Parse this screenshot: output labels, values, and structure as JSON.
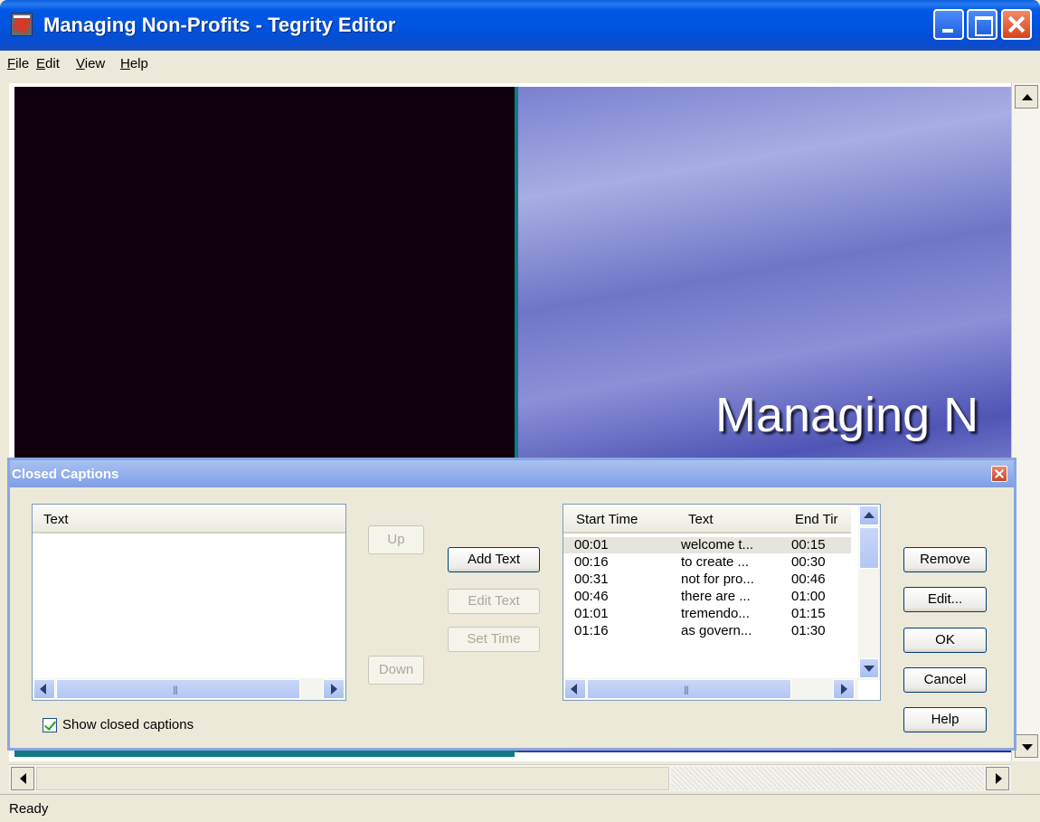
{
  "window": {
    "title": "Managing Non-Profits - Tegrity Editor"
  },
  "menu": [
    {
      "label": "File",
      "key": "F",
      "rest": "ile"
    },
    {
      "label": "Edit",
      "key": "E",
      "rest": "dit"
    },
    {
      "label": "View",
      "key": "V",
      "rest": "iew"
    },
    {
      "label": "Help",
      "key": "H",
      "rest": "elp"
    }
  ],
  "slide": {
    "title": "Managing N"
  },
  "status": {
    "text": "Ready"
  },
  "dialog": {
    "title": "Closed Captions",
    "text_list": {
      "header": "Text"
    },
    "buttons": {
      "up": "Up",
      "down": "Down",
      "add_text": "Add Text",
      "edit_text": "Edit Text",
      "set_time": "Set Time",
      "remove": "Remove",
      "edit": "Edit...",
      "ok": "OK",
      "cancel": "Cancel",
      "help": "Help"
    },
    "caption_list": {
      "headers": [
        "Start Time",
        "Text",
        "End Tir"
      ],
      "rows": [
        {
          "start": "00:01",
          "text": "welcome t...",
          "end": "00:15"
        },
        {
          "start": "00:16",
          "text": "to create ...",
          "end": "00:30"
        },
        {
          "start": "00:31",
          "text": "not for pro...",
          "end": "00:46"
        },
        {
          "start": "00:46",
          "text": "there are ...",
          "end": "01:00"
        },
        {
          "start": "01:01",
          "text": "tremendo...",
          "end": "01:15"
        },
        {
          "start": "01:16",
          "text": "as govern...",
          "end": "01:30"
        }
      ]
    },
    "show_captions": {
      "label": "Show closed captions",
      "checked": true
    }
  }
}
